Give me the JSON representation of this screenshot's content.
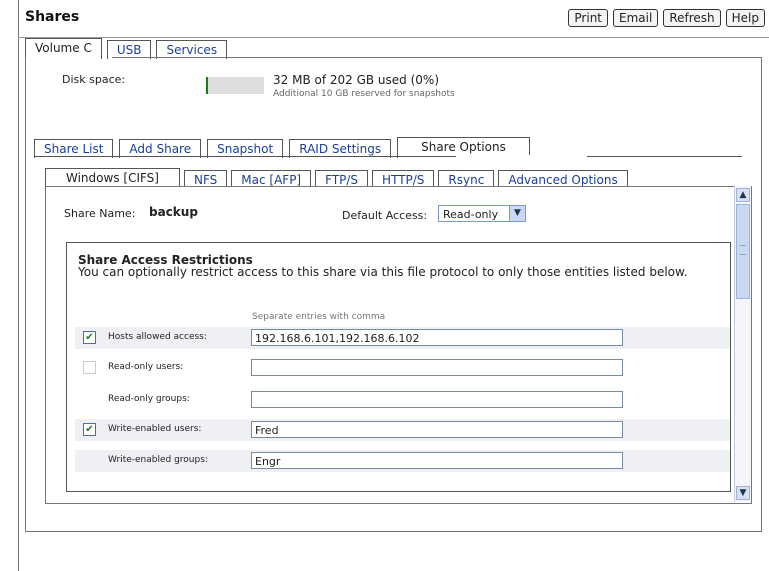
{
  "header": {
    "title": "Shares",
    "buttons": {
      "print": "Print",
      "email": "Email",
      "refresh": "Refresh",
      "help": "Help"
    }
  },
  "volume_tabs": [
    "Volume C",
    "USB",
    "Services"
  ],
  "disk": {
    "label": "Disk space:",
    "used_text": "32 MB of 202 GB used (0%)",
    "reserved_text": "Additional 10 GB reserved for snapshots",
    "used_fraction": 0
  },
  "main_tabs": [
    "Share List",
    "Add Share",
    "Snapshot",
    "RAID Settings",
    "Share Options"
  ],
  "protocol_tabs": [
    "Windows [CIFS]",
    "NFS",
    "Mac [AFP]",
    "FTP/S",
    "HTTP/S",
    "Rsync",
    "Advanced Options"
  ],
  "share": {
    "name_label": "Share Name:",
    "name_value": "backup",
    "default_access_label": "Default Access:",
    "default_access_value": "Read-only"
  },
  "restrictions": {
    "title": "Share Access Restrictions",
    "description": "You can optionally restrict access to this share via this file protocol to only those entities listed below.",
    "note": "Separate entries with comma",
    "rows": [
      {
        "label": "Hosts allowed access:",
        "checkbox": "checked",
        "value": "192.168.6.101,192.168.6.102"
      },
      {
        "label": "Read-only users:",
        "checkbox": "disabled",
        "value": ""
      },
      {
        "label": "Read-only groups:",
        "checkbox": "none",
        "value": ""
      },
      {
        "label": "Write-enabled users:",
        "checkbox": "checked",
        "value": "Fred"
      },
      {
        "label": "Write-enabled groups:",
        "checkbox": "none",
        "value": "Engr"
      }
    ]
  }
}
